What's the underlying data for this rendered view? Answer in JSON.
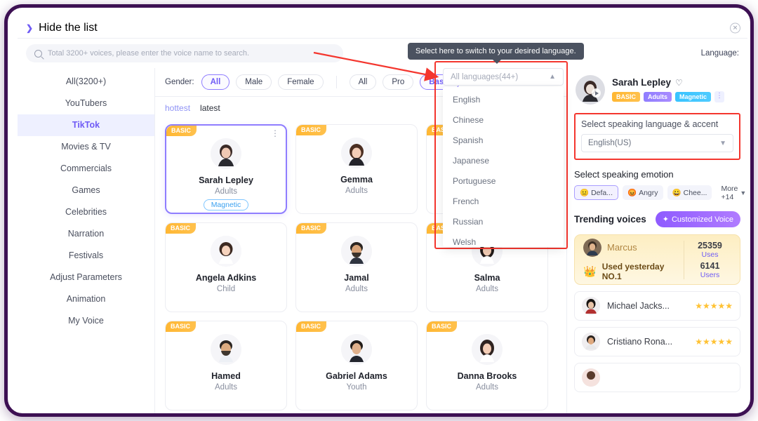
{
  "window": {
    "hide_list_label": "Hide the list",
    "close_icon": "close-icon"
  },
  "search": {
    "placeholder": "Total 3200+ voices, please enter the voice name to search.",
    "icon": "search-icon"
  },
  "language": {
    "label": "Language:",
    "selected": "All languages(44+)",
    "tooltip": "Select here to switch to your desired language.",
    "options": [
      "English",
      "Chinese",
      "Spanish",
      "Japanese",
      "Portuguese",
      "French",
      "Russian",
      "Welsh"
    ]
  },
  "sidebar": {
    "items": [
      {
        "label": "All(3200+)",
        "active": false
      },
      {
        "label": "YouTubers",
        "active": false
      },
      {
        "label": "TikTok",
        "active": true
      },
      {
        "label": "Movies & TV",
        "active": false
      },
      {
        "label": "Commercials",
        "active": false
      },
      {
        "label": "Games",
        "active": false
      },
      {
        "label": "Celebrities",
        "active": false
      },
      {
        "label": "Narration",
        "active": false
      },
      {
        "label": "Festivals",
        "active": false
      },
      {
        "label": "Adjust Parameters",
        "active": false
      },
      {
        "label": "Animation",
        "active": false
      },
      {
        "label": "My Voice",
        "active": false
      }
    ]
  },
  "filters": {
    "gender_label": "Gender:",
    "gender": [
      {
        "label": "All",
        "selected": true
      },
      {
        "label": "Male",
        "selected": false
      },
      {
        "label": "Female",
        "selected": false
      }
    ],
    "plan": [
      {
        "label": "All",
        "selected": false
      },
      {
        "label": "Pro",
        "selected": false
      },
      {
        "label": "Basic",
        "selected": true
      }
    ],
    "sort": [
      {
        "label": "hottest",
        "active": true
      },
      {
        "label": "latest",
        "active": false
      }
    ]
  },
  "cards": [
    {
      "badge": "BASIC",
      "name": "Sarah Lepley",
      "age": "Adults",
      "tag": "Magnetic",
      "selected": true
    },
    {
      "badge": "BASIC",
      "name": "Gemma",
      "age": "Adults",
      "tag": "",
      "selected": false
    },
    {
      "badge": "BASIC",
      "name": "",
      "age": "",
      "tag": "",
      "selected": false
    },
    {
      "badge": "BASIC",
      "name": "Angela Adkins",
      "age": "Child",
      "tag": "",
      "selected": false
    },
    {
      "badge": "BASIC",
      "name": "Jamal",
      "age": "Adults",
      "tag": "",
      "selected": false
    },
    {
      "badge": "BASIC",
      "name": "Salma",
      "age": "Adults",
      "tag": "",
      "selected": false
    },
    {
      "badge": "BASIC",
      "name": "Hamed",
      "age": "Adults",
      "tag": "",
      "selected": false
    },
    {
      "badge": "BASIC",
      "name": "Gabriel Adams",
      "age": "Youth",
      "tag": "",
      "selected": false
    },
    {
      "badge": "BASIC",
      "name": "Danna Brooks",
      "age": "Adults",
      "tag": "",
      "selected": false
    }
  ],
  "panel": {
    "voice_name": "Sarah Lepley",
    "heart_icon": "heart-icon",
    "tags": [
      "BASIC",
      "Adults",
      "Magnetic"
    ],
    "kebab_icon": "more-vertical-icon",
    "accent_section_title": "Select speaking language & accent",
    "accent_value": "English(US)",
    "emotion_section_title": "Select speaking emotion",
    "emotions": [
      {
        "emoji": "😐",
        "label": "Defa...",
        "selected": true
      },
      {
        "emoji": "😡",
        "label": "Angry",
        "selected": false
      },
      {
        "emoji": "😀",
        "label": "Chee...",
        "selected": false
      }
    ],
    "emotion_more": "More +14",
    "trending_title": "Trending voices",
    "customized_button": "Customized Voice",
    "customized_icon": "sparkle-icon",
    "marcus": {
      "name": "Marcus",
      "subtitle": "Used yesterday NO.1",
      "crown_icon": "crown-icon",
      "uses_value": "25359",
      "uses_label": "Uses",
      "users_value": "6141",
      "users_label": "Users"
    },
    "voice_rows": [
      {
        "name": "Michael Jacks...",
        "stars": "★★★★★"
      },
      {
        "name": "Cristiano Rona...",
        "stars": "★★★★★"
      },
      {
        "name": "",
        "stars": ""
      }
    ]
  },
  "colors": {
    "frame": "#3d1053",
    "accent": "#6f5bf5",
    "highlight_red": "#f4362e",
    "badge_orange": "#ffb733",
    "star_yellow": "#ffc233"
  }
}
